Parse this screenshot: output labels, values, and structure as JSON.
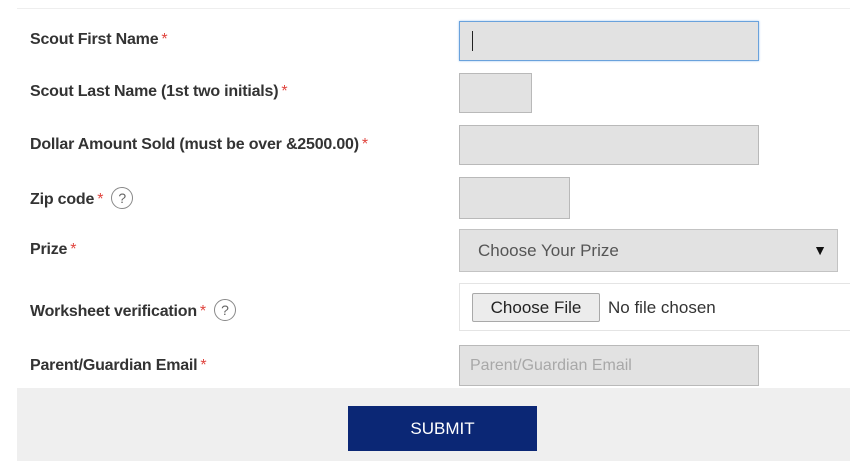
{
  "form": {
    "fields": [
      {
        "label": "Scout First Name",
        "required": "*",
        "value": "",
        "placeholder": ""
      },
      {
        "label": "Scout Last Name (1st two initials)",
        "required": "*",
        "value": "",
        "placeholder": ""
      },
      {
        "label": "Dollar Amount Sold (must be over &2500.00)",
        "required": "*",
        "value": "",
        "placeholder": ""
      },
      {
        "label": "Zip code",
        "required": "*",
        "help": "?",
        "value": "",
        "placeholder": ""
      },
      {
        "label": "Prize",
        "required": "*",
        "selected": "Choose Your Prize",
        "arrow": "▼"
      },
      {
        "label": "Worksheet verification",
        "required": "*",
        "help": "?",
        "button_label": "Choose File",
        "status": "No file chosen"
      },
      {
        "label": "Parent/Guardian Email",
        "required": "*",
        "value": "",
        "placeholder": "Parent/Guardian Email"
      }
    ],
    "submit_label": "SUBMIT"
  },
  "colors": {
    "required_asterisk": "#e0443e",
    "submit_background": "#0b2775",
    "input_background": "#e2e2e2",
    "footer_background": "#efefef",
    "focus_border": "#6aa2dc"
  },
  "icons": {
    "help": "question-circle-icon",
    "dropdown": "triangle-down-icon"
  }
}
